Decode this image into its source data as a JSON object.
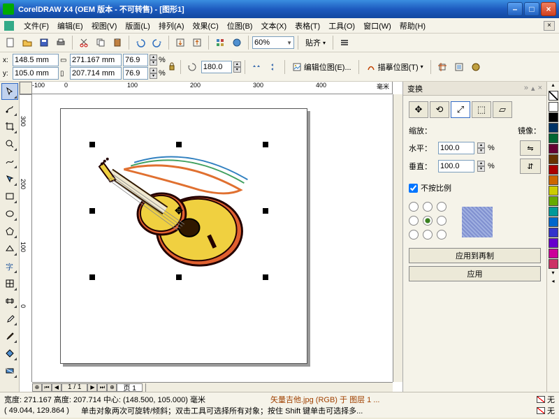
{
  "title": "CorelDRAW X4 (OEM 版本 - 不可转售) - [图形1]",
  "menu": {
    "file": "文件(F)",
    "edit": "编辑(E)",
    "view": "视图(V)",
    "layout": "版面(L)",
    "arrange": "排列(A)",
    "effects": "效果(C)",
    "bitmaps": "位图(B)",
    "text": "文本(X)",
    "table": "表格(T)",
    "tools": "工具(O)",
    "window": "窗口(W)",
    "help": "帮助(H)"
  },
  "std_toolbar": {
    "zoom": "60%",
    "snap": "贴齐"
  },
  "prop_bar": {
    "x": "148.5 mm",
    "y": "105.0 mm",
    "w": "271.167 mm",
    "h": "207.714 mm",
    "sx": "76.9",
    "sy": "76.9",
    "angle": "180.0",
    "edit_bitmap": "编辑位图(E)...",
    "trace_bitmap": "描摹位图(T)"
  },
  "ruler_ticks_h": [
    "-100",
    "0",
    "100",
    "200",
    "300",
    "400"
  ],
  "ruler_unit": "毫米",
  "ruler_ticks_v": [
    "300",
    "200",
    "100",
    "0"
  ],
  "page_nav": {
    "counter": "1 / 1",
    "tab": "页 1"
  },
  "docker": {
    "title": "变换",
    "scale_label": "缩放：",
    "mirror_label": "镜像：",
    "h_label": "水平：",
    "v_label": "垂直：",
    "h_val": "100.0",
    "v_val": "100.0",
    "pct": "%",
    "proportional": "不按比例",
    "apply_dup": "应用到再制",
    "apply": "应用"
  },
  "palette_colors": [
    "#ffffff",
    "#000000",
    "#003366",
    "#006633",
    "#660033",
    "#663300",
    "#aa0000",
    "#cc6600",
    "#cccc00",
    "#66aa00",
    "#009999",
    "#0066cc",
    "#3333cc",
    "#6600cc",
    "#cc0099",
    "#cc3366"
  ],
  "status": {
    "line1a": "宽度: 271.167 高度: 207.714 中心: (148.500, 105.000) 毫米",
    "line1b": "矢量吉他.jpg (RGB) 于 图层 1 ...",
    "line2a": "( 49.044, 129.864 )",
    "line2b": "单击对象两次可旋转/倾斜；双击工具可选择所有对象；按住 Shift 键单击可选择多...",
    "none": "无"
  }
}
